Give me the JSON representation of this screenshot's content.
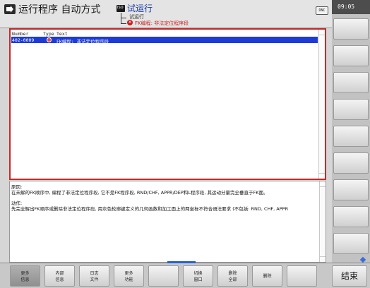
{
  "header": {
    "title": "运行程序 自动方式",
    "sub_title": "试运行",
    "tree_item_1": "试运行",
    "tree_item_2": "FK编程: 非法定位程序段",
    "dnc": "DNC"
  },
  "clock": "09:05",
  "table": {
    "columns": [
      "Number",
      "Type",
      "Text"
    ],
    "rows": [
      {
        "number": "402-0009",
        "type": "error-icon",
        "text": "FK编程: 非法定位程序段"
      }
    ]
  },
  "info": {
    "cause_label": "原因:",
    "cause_text": "在未解的FK顺序中, 编程了非法定位程序段, 它不是FK程序段, RND/CHF, APPR/DEP和L程序段, 其运动分量完全垂直于FK面。",
    "action_label": "动作:",
    "action_text": "先完全解出FK顺序或删除非法定位程序段, 用灰色轮廓键定义的几何函数和加工面上的两坐标不符合语法要求 (不包括: RND, CHF, APPR"
  },
  "softkeys": [
    {
      "line1": "更多",
      "line2": "信息"
    },
    {
      "line1": "内部",
      "line2": "信息"
    },
    {
      "line1": "日志",
      "line2": "文件"
    },
    {
      "line1": "更多",
      "line2": "功能"
    },
    {
      "line1": "",
      "line2": ""
    },
    {
      "line1": "切换",
      "line2": "窗口"
    },
    {
      "line1": "删除",
      "line2": "全部"
    },
    {
      "line1": "删除",
      "line2": ""
    },
    {
      "line1": "",
      "line2": ""
    }
  ],
  "end_key": "结束",
  "colors": {
    "accent": "#1e3bd8",
    "error": "#c42a2a"
  }
}
